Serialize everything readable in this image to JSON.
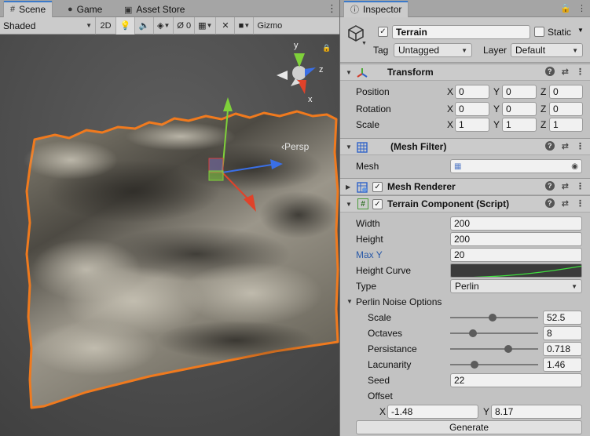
{
  "scene_panel": {
    "tabs": [
      {
        "label": "Scene",
        "icon": "hash-icon"
      },
      {
        "label": "Game",
        "icon": "gamepad-icon"
      },
      {
        "label": "Asset Store",
        "icon": "store-icon"
      }
    ],
    "toolbar": {
      "shading_mode": "Shaded",
      "mode_2d": "2D",
      "gizmos_label": "Gizmo"
    },
    "persp_label": "‹Persp",
    "gizmo_axes": {
      "y": "y",
      "z": "z",
      "x": "x"
    }
  },
  "inspector": {
    "tab_label": "Inspector",
    "gameobject": {
      "active": true,
      "name": "Terrain",
      "static_label": "Static",
      "tag_label": "Tag",
      "tag_value": "Untagged",
      "layer_label": "Layer",
      "layer_value": "Default"
    },
    "transform": {
      "title": "Transform",
      "rows": [
        {
          "label": "Position",
          "x": "0",
          "y": "0",
          "z": "0"
        },
        {
          "label": "Rotation",
          "x": "0",
          "y": "0",
          "z": "0"
        },
        {
          "label": "Scale",
          "x": "1",
          "y": "1",
          "z": "1"
        }
      ],
      "axis_x": "X",
      "axis_y": "Y",
      "axis_z": "Z"
    },
    "mesh_filter": {
      "title": "(Mesh Filter)",
      "mesh_label": "Mesh"
    },
    "mesh_renderer": {
      "title": "Mesh Renderer"
    },
    "terrain_component": {
      "title": "Terrain Component (Script)",
      "width_label": "Width",
      "width": "200",
      "height_label": "Height",
      "height": "200",
      "maxy_label": "Max Y",
      "maxy": "20",
      "curve_label": "Height Curve",
      "type_label": "Type",
      "type": "Perlin",
      "perlin_label": "Perlin Noise Options",
      "scale_label": "Scale",
      "scale": "52.5",
      "scale_frac": 0.48,
      "octaves_label": "Octaves",
      "octaves": "8",
      "octaves_frac": 0.24,
      "persistance_label": "Persistance",
      "persistance": "0.718",
      "persistance_frac": 0.68,
      "lacunarity_label": "Lacunarity",
      "lacunarity": "1.46",
      "lacunarity_frac": 0.25,
      "seed_label": "Seed",
      "seed": "22",
      "offset_label": "Offset",
      "offset_x_label": "X",
      "offset_x": "-1.48",
      "offset_y_label": "Y",
      "offset_y": "8.17",
      "generate_label": "Generate"
    }
  }
}
